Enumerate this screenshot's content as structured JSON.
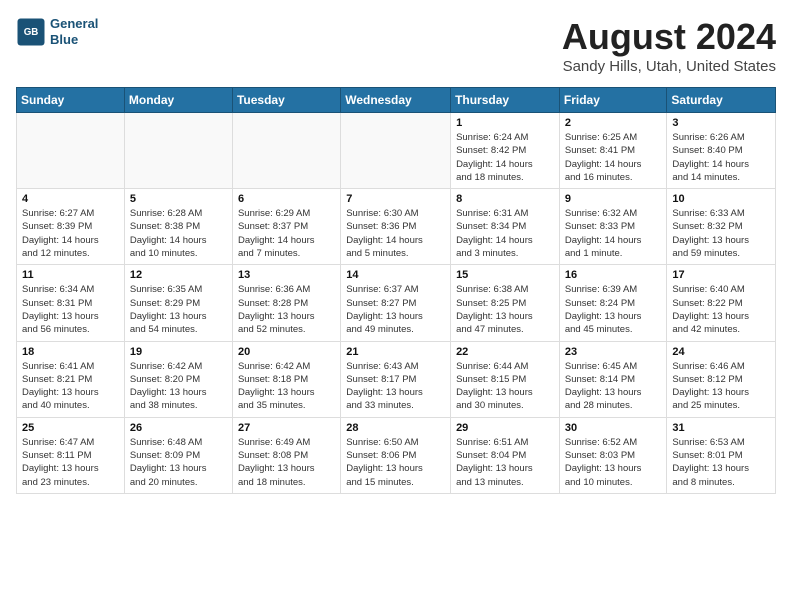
{
  "header": {
    "logo_line1": "General",
    "logo_line2": "Blue",
    "month": "August 2024",
    "location": "Sandy Hills, Utah, United States"
  },
  "weekdays": [
    "Sunday",
    "Monday",
    "Tuesday",
    "Wednesday",
    "Thursday",
    "Friday",
    "Saturday"
  ],
  "weeks": [
    [
      {
        "day": "",
        "info": ""
      },
      {
        "day": "",
        "info": ""
      },
      {
        "day": "",
        "info": ""
      },
      {
        "day": "",
        "info": ""
      },
      {
        "day": "1",
        "info": "Sunrise: 6:24 AM\nSunset: 8:42 PM\nDaylight: 14 hours\nand 18 minutes."
      },
      {
        "day": "2",
        "info": "Sunrise: 6:25 AM\nSunset: 8:41 PM\nDaylight: 14 hours\nand 16 minutes."
      },
      {
        "day": "3",
        "info": "Sunrise: 6:26 AM\nSunset: 8:40 PM\nDaylight: 14 hours\nand 14 minutes."
      }
    ],
    [
      {
        "day": "4",
        "info": "Sunrise: 6:27 AM\nSunset: 8:39 PM\nDaylight: 14 hours\nand 12 minutes."
      },
      {
        "day": "5",
        "info": "Sunrise: 6:28 AM\nSunset: 8:38 PM\nDaylight: 14 hours\nand 10 minutes."
      },
      {
        "day": "6",
        "info": "Sunrise: 6:29 AM\nSunset: 8:37 PM\nDaylight: 14 hours\nand 7 minutes."
      },
      {
        "day": "7",
        "info": "Sunrise: 6:30 AM\nSunset: 8:36 PM\nDaylight: 14 hours\nand 5 minutes."
      },
      {
        "day": "8",
        "info": "Sunrise: 6:31 AM\nSunset: 8:34 PM\nDaylight: 14 hours\nand 3 minutes."
      },
      {
        "day": "9",
        "info": "Sunrise: 6:32 AM\nSunset: 8:33 PM\nDaylight: 14 hours\nand 1 minute."
      },
      {
        "day": "10",
        "info": "Sunrise: 6:33 AM\nSunset: 8:32 PM\nDaylight: 13 hours\nand 59 minutes."
      }
    ],
    [
      {
        "day": "11",
        "info": "Sunrise: 6:34 AM\nSunset: 8:31 PM\nDaylight: 13 hours\nand 56 minutes."
      },
      {
        "day": "12",
        "info": "Sunrise: 6:35 AM\nSunset: 8:29 PM\nDaylight: 13 hours\nand 54 minutes."
      },
      {
        "day": "13",
        "info": "Sunrise: 6:36 AM\nSunset: 8:28 PM\nDaylight: 13 hours\nand 52 minutes."
      },
      {
        "day": "14",
        "info": "Sunrise: 6:37 AM\nSunset: 8:27 PM\nDaylight: 13 hours\nand 49 minutes."
      },
      {
        "day": "15",
        "info": "Sunrise: 6:38 AM\nSunset: 8:25 PM\nDaylight: 13 hours\nand 47 minutes."
      },
      {
        "day": "16",
        "info": "Sunrise: 6:39 AM\nSunset: 8:24 PM\nDaylight: 13 hours\nand 45 minutes."
      },
      {
        "day": "17",
        "info": "Sunrise: 6:40 AM\nSunset: 8:22 PM\nDaylight: 13 hours\nand 42 minutes."
      }
    ],
    [
      {
        "day": "18",
        "info": "Sunrise: 6:41 AM\nSunset: 8:21 PM\nDaylight: 13 hours\nand 40 minutes."
      },
      {
        "day": "19",
        "info": "Sunrise: 6:42 AM\nSunset: 8:20 PM\nDaylight: 13 hours\nand 38 minutes."
      },
      {
        "day": "20",
        "info": "Sunrise: 6:42 AM\nSunset: 8:18 PM\nDaylight: 13 hours\nand 35 minutes."
      },
      {
        "day": "21",
        "info": "Sunrise: 6:43 AM\nSunset: 8:17 PM\nDaylight: 13 hours\nand 33 minutes."
      },
      {
        "day": "22",
        "info": "Sunrise: 6:44 AM\nSunset: 8:15 PM\nDaylight: 13 hours\nand 30 minutes."
      },
      {
        "day": "23",
        "info": "Sunrise: 6:45 AM\nSunset: 8:14 PM\nDaylight: 13 hours\nand 28 minutes."
      },
      {
        "day": "24",
        "info": "Sunrise: 6:46 AM\nSunset: 8:12 PM\nDaylight: 13 hours\nand 25 minutes."
      }
    ],
    [
      {
        "day": "25",
        "info": "Sunrise: 6:47 AM\nSunset: 8:11 PM\nDaylight: 13 hours\nand 23 minutes."
      },
      {
        "day": "26",
        "info": "Sunrise: 6:48 AM\nSunset: 8:09 PM\nDaylight: 13 hours\nand 20 minutes."
      },
      {
        "day": "27",
        "info": "Sunrise: 6:49 AM\nSunset: 8:08 PM\nDaylight: 13 hours\nand 18 minutes."
      },
      {
        "day": "28",
        "info": "Sunrise: 6:50 AM\nSunset: 8:06 PM\nDaylight: 13 hours\nand 15 minutes."
      },
      {
        "day": "29",
        "info": "Sunrise: 6:51 AM\nSunset: 8:04 PM\nDaylight: 13 hours\nand 13 minutes."
      },
      {
        "day": "30",
        "info": "Sunrise: 6:52 AM\nSunset: 8:03 PM\nDaylight: 13 hours\nand 10 minutes."
      },
      {
        "day": "31",
        "info": "Sunrise: 6:53 AM\nSunset: 8:01 PM\nDaylight: 13 hours\nand 8 minutes."
      }
    ]
  ]
}
